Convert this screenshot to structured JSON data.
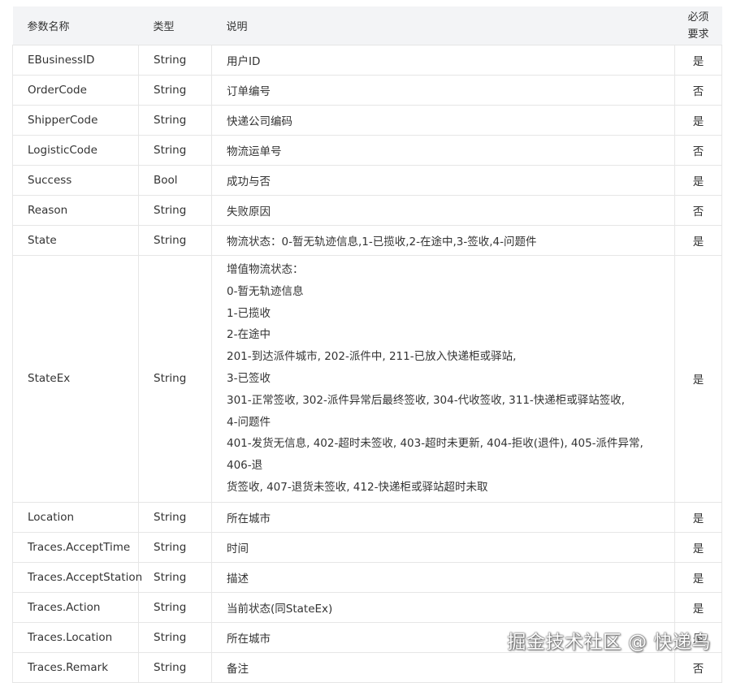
{
  "header": {
    "name": "参数名称",
    "type": "类型",
    "desc": "说明",
    "required_1": "必须",
    "required_2": "要求"
  },
  "rows": [
    {
      "name": "EBusinessID",
      "type": "String",
      "desc": "用户ID",
      "req": "是"
    },
    {
      "name": "OrderCode",
      "type": "String",
      "desc": "订单编号",
      "req": "否"
    },
    {
      "name": "ShipperCode",
      "type": "String",
      "desc": "快递公司编码",
      "req": "是"
    },
    {
      "name": "LogisticCode",
      "type": "String",
      "desc": "物流运单号",
      "req": "否"
    },
    {
      "name": "Success",
      "type": "Bool",
      "desc": "成功与否",
      "req": "是"
    },
    {
      "name": "Reason",
      "type": "String",
      "desc": "失败原因",
      "req": "否"
    },
    {
      "name": "State",
      "type": "String",
      "desc": "物流状态：0-暂无轨迹信息,1-已揽收,2-在途中,3-签收,4-问题件",
      "req": "是"
    },
    {
      "name": "StateEx",
      "type": "String",
      "desc_lines": [
        "增值物流状态：",
        "0-暂无轨迹信息",
        "1-已揽收",
        "2-在途中",
        "201-到达派件城市, 202-派件中, 211-已放入快递柜或驿站,",
        "3-已签收",
        "301-正常签收, 302-派件异常后最终签收, 304-代收签收, 311-快递柜或驿站签收,",
        "4-问题件",
        "401-发货无信息, 402-超时未签收, 403-超时未更新, 404-拒收(退件), 405-派件异常, 406-退",
        "货签收, 407-退货未签收, 412-快递柜或驿站超时未取"
      ],
      "req": "是"
    },
    {
      "name": "Location",
      "type": "String",
      "desc": "所在城市",
      "req": "是"
    },
    {
      "name": "Traces.AcceptTime",
      "type": "String",
      "desc": "时间",
      "req": "是"
    },
    {
      "name": "Traces.AcceptStation",
      "type": "String",
      "desc": "描述",
      "req": "是"
    },
    {
      "name": "Traces.Action",
      "type": "String",
      "desc": "当前状态(同StateEx)",
      "req": "是"
    },
    {
      "name": "Traces.Location",
      "type": "String",
      "desc": "所在城市",
      "req": "是"
    },
    {
      "name": "Traces.Remark",
      "type": "String",
      "desc": "备注",
      "req": "否"
    }
  ],
  "watermark": "掘金技术社区 @ 快递鸟"
}
